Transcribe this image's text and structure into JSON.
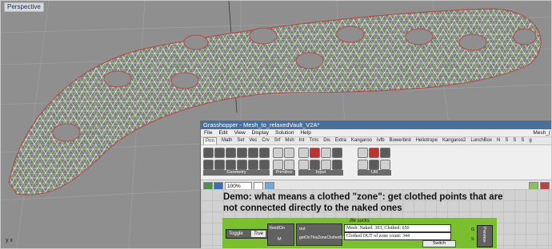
{
  "viewport": {
    "label": "Perspective",
    "axis": "y x"
  },
  "grasshopper": {
    "title": "Grasshopper - Mesh_to_relaxedVault_V2A*",
    "menu": [
      "File",
      "Edit",
      "View",
      "Display",
      "Solution",
      "Help"
    ],
    "right_label": "Mesh_(",
    "tabs": [
      "Prm",
      "Math",
      "Set",
      "Vec",
      "Crv",
      "Srf",
      "Msh",
      "Int",
      "Trns",
      "Dis",
      "Extra",
      "Kangaroo",
      "Ivfb",
      "Bowerbird",
      "Heliotrope",
      "Kangaroo2",
      "LunchBox",
      "N",
      "S",
      "S",
      "S",
      "g"
    ],
    "active_tab": "Prm",
    "ribbon_groups": [
      "Geometry",
      "Primitive",
      "Input",
      "Util"
    ],
    "zoom": "100%",
    "demo_text": "Demo: what means a clothed \"zone\": get clothed points that are not connected directly to the naked ones",
    "group_title": "life sucks",
    "toggle_label": "Toggle",
    "toggle_value": "True",
    "comp_in": "fixedOn",
    "comp_out": "out",
    "comp_code": "getOnThisZoneClothedLns",
    "comp_side": "M",
    "panel_line1": "Mesh: Naked: 303, Clothed: 650",
    "panel_line2": "Clothed OUT of zone count: 344",
    "switch_label": "Switch",
    "preview_label": "Preview",
    "preview_ports": [
      "G",
      "S"
    ]
  }
}
